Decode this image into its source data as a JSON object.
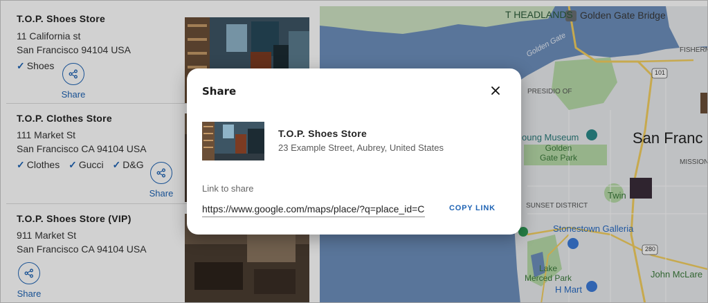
{
  "stores": [
    {
      "name": "T.O.P. Shoes Store",
      "address_line1": "11 California st",
      "address_line2": "San Francisco 94104 USA",
      "tags": [
        "Shoes"
      ],
      "share_label": "Share"
    },
    {
      "name": "T.O.P. Clothes Store",
      "address_line1": "111 Market St",
      "address_line2": "San Francisco CA 94104 USA",
      "tags": [
        "Clothes",
        "Gucci",
        "D&G"
      ],
      "share_label": "Share"
    },
    {
      "name": "T.O.P. Shoes Store (VIP)",
      "address_line1": "911 Market St",
      "address_line2": "San Francisco CA 94104 USA",
      "tags": [],
      "share_label": "Share"
    }
  ],
  "map": {
    "labels": {
      "headlands": "T HEADLANDS",
      "golden_gate_bridge": "Golden Gate Bridge",
      "golden_gate": "Golden Gate",
      "fisherman": "FISHERM",
      "presidio": "PRESIDIO OF",
      "san_francisco": "San Franc",
      "museum": "oung Museum",
      "golden_gate_park": "Golden\nGate Park",
      "mission": "MISSION",
      "sunset": "SUNSET DISTRICT",
      "twin": "Twin",
      "stonestown": "Stonestown Galleria",
      "lake_merced": "Lake\nMerced Park",
      "john_mclaren": "John McLare",
      "h_mart": "H Mart",
      "hwy_101": "101",
      "hwy_280": "280"
    },
    "colors": {
      "water": "#6d8fbc",
      "land": "#e9ecee",
      "park": "#b8dba9",
      "highway": "#f3cf60"
    }
  },
  "dialog": {
    "title": "Share",
    "close_icon": "close-icon",
    "store_name": "T.O.P. Shoes Store",
    "store_address": "23 Example Street, Aubrey, United States",
    "link_label": "Link to share",
    "link_value": "https://www.google.com/maps/place/?q=place_id=ChIJ",
    "copy_label": "COPY LINK"
  },
  "colors": {
    "accent": "#1e63b4",
    "overlay": "rgba(0,0,0,0.18)"
  }
}
